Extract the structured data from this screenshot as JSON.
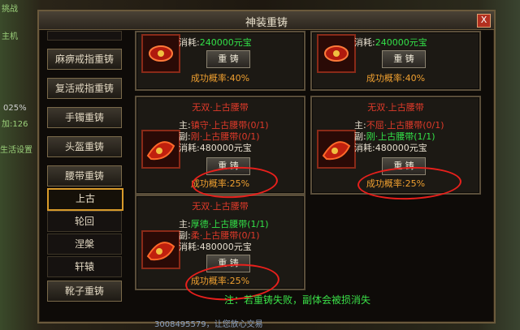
{
  "window": {
    "title": "神装重铸",
    "close_label": "X"
  },
  "nav": [
    {
      "label": "麻痹戒指重铸"
    },
    {
      "label": "复活戒指重铸"
    },
    {
      "label": "手镯重铸"
    },
    {
      "label": "头盔重铸"
    },
    {
      "label": "腰带重铸"
    },
    {
      "label": "上古"
    },
    {
      "label": "轮回"
    },
    {
      "label": "涅槃"
    },
    {
      "label": "轩辕"
    },
    {
      "label": "靴子重铸"
    }
  ],
  "panels": {
    "top_left": {
      "cost_label": "消耗:",
      "cost": "240000元宝",
      "button": "重 铸",
      "rate": "成功概率:40%"
    },
    "top_right": {
      "cost_label": "消耗:",
      "cost": "240000元宝",
      "button": "重 铸",
      "rate": "成功概率:40%"
    },
    "mid_left": {
      "title": "无双·上古腰带",
      "main_label": "主:",
      "main": "镇守·上古腰带(0/1)",
      "sub_label": "副:",
      "sub": "刚·上古腰带(0/1)",
      "cost_label": "消耗:",
      "cost": "480000元宝",
      "button": "重 铸",
      "rate": "成功概率:25%"
    },
    "mid_right": {
      "title": "无双·上古腰带",
      "main_label": "主:",
      "main": "不屈·上古腰带(0/1)",
      "sub_label": "副:",
      "sub": "刚·上古腰带(1/1)",
      "cost_label": "消耗:",
      "cost": "480000元宝",
      "button": "重 铸",
      "rate": "成功概率:25%"
    },
    "bottom_left": {
      "title": "无双·上古腰带",
      "main_label": "主:",
      "main": "厚德·上古腰带(1/1)",
      "sub_label": "副:",
      "sub": "柔·上古腰带(0/1)",
      "cost_label": "消耗:",
      "cost": "480000元宝",
      "button": "重 铸",
      "rate": "成功概率:25%"
    }
  },
  "note": "注：若重铸失败，副体会被损消失",
  "left_hud": [
    "挑战",
    "主机",
    "025%",
    "加:126",
    "生活设置"
  ],
  "bottom_hud": "3008495579，让您放心交易"
}
